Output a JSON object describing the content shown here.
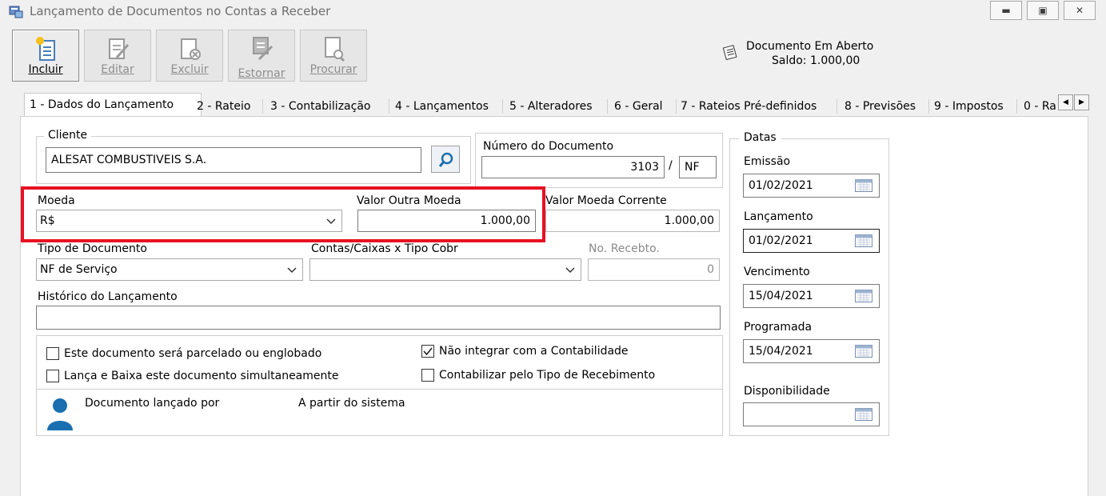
{
  "window": {
    "title": "Lançamento de Documentos no Contas a Receber"
  },
  "toolbar": {
    "incluir": "Incluir",
    "editar": "Editar",
    "excluir": "Excluir",
    "estornar": "Estornar",
    "procurar": "Procurar"
  },
  "status": {
    "line1": "Documento Em Aberto",
    "line2": "Saldo: 1.000,00"
  },
  "tabs": [
    "1 - Dados do Lançamento",
    "2 - Rateio",
    "3 - Contabilização",
    "4 - Lançamentos",
    "5 - Alteradores",
    "6 - Geral",
    "7 - Rateios Pré-definidos",
    "8 - Previsões",
    "9 - Impostos",
    "0 - Ra"
  ],
  "form": {
    "cliente_label": "Cliente",
    "cliente_value": "ALESAT COMBUSTIVEIS S.A.",
    "numero_label": "Número do Documento",
    "numero_value": "3103",
    "numero_sep": "/",
    "numero_tipo": "NF",
    "moeda_label": "Moeda",
    "moeda_value": "R$",
    "valor_outra_label": "Valor Outra Moeda",
    "valor_outra_value": "1.000,00",
    "valor_corrente_label": "Valor Moeda Corrente",
    "valor_corrente_value": "1.000,00",
    "tipo_doc_label": "Tipo de Documento",
    "tipo_doc_value": "NF de Serviço",
    "contas_label": "Contas/Caixas x Tipo Cobr",
    "contas_value": "",
    "recebto_label": "No. Recebto.",
    "recebto_value": "0",
    "historico_label": "Histórico do Lançamento",
    "historico_value": ""
  },
  "checks": {
    "parcelado": {
      "label": "Este documento será parcelado ou englobado",
      "checked": false
    },
    "lanca_baixa": {
      "label": "Lança e Baixa este documento simultaneamente",
      "checked": false
    },
    "nao_integrar": {
      "label": "Não integrar com a Contabilidade",
      "checked": true
    },
    "contabilizar": {
      "label": "Contabilizar pelo Tipo de Recebimento",
      "checked": false
    }
  },
  "footer": {
    "lancado_por": "Documento lançado por",
    "origem": "A partir do sistema"
  },
  "datas": {
    "title": "Datas",
    "emissao_label": "Emissão",
    "emissao_value": "01/02/2021",
    "lancamento_label": "Lançamento",
    "lancamento_value": "01/02/2021",
    "vencimento_label": "Vencimento",
    "vencimento_value": "15/04/2021",
    "programada_label": "Programada",
    "programada_value": "15/04/2021",
    "disponibilidade_label": "Disponibilidade",
    "disponibilidade_value": ""
  },
  "colors": {
    "highlight": "#e81123",
    "accent": "#1a6fb0"
  },
  "icons": [
    "app-icon",
    "new-document-icon",
    "edit-document-icon",
    "delete-document-icon",
    "reverse-icon",
    "search-document-icon",
    "notepad-icon",
    "search-icon",
    "calendar-icon",
    "user-icon",
    "chevron-down-icon"
  ]
}
